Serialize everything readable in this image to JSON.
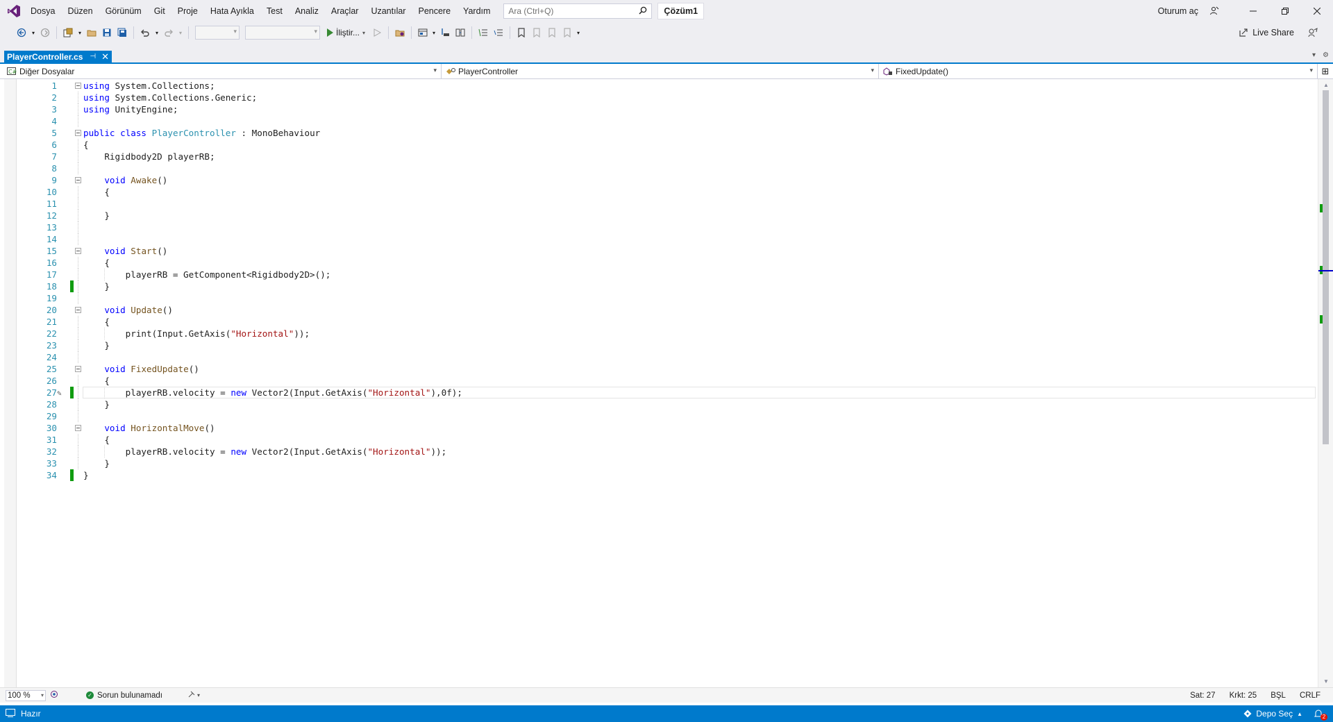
{
  "menu": {
    "items": [
      "Dosya",
      "Düzen",
      "Görünüm",
      "Git",
      "Proje",
      "Hata Ayıkla",
      "Test",
      "Analiz",
      "Araçlar",
      "Uzantılar",
      "Pencere",
      "Yardım"
    ],
    "search_placeholder": "Ara (Ctrl+Q)",
    "solution_name": "Çözüm1",
    "signin_label": "Oturum aç"
  },
  "toolbar": {
    "run_label": "İliştir...",
    "liveshare_label": "Live Share"
  },
  "tab": {
    "filename": "PlayerController.cs"
  },
  "navbar": {
    "project": "Diğer Dosyalar",
    "class": "PlayerController",
    "member": "FixedUpdate()"
  },
  "editor": {
    "lines": [
      "using System.Collections;",
      "using System.Collections.Generic;",
      "using UnityEngine;",
      "",
      "public class PlayerController : MonoBehaviour",
      "{",
      "    Rigidbody2D playerRB;",
      "",
      "    void Awake()",
      "    {",
      "",
      "    }",
      "",
      "",
      "    void Start()",
      "    {",
      "        playerRB = GetComponent<Rigidbody2D>();",
      "    }",
      "",
      "    void Update()",
      "    {",
      "        print(Input.GetAxis(\"Horizontal\"));",
      "    }",
      "",
      "    void FixedUpdate()",
      "    {",
      "        playerRB.velocity = new Vector2(Input.GetAxis(\"Horizontal\"),0f);",
      "    }",
      "",
      "    void HorizontalMove()",
      "    {",
      "        playerRB.velocity = new Vector2(Input.GetAxis(\"Horizontal\"));",
      "    }",
      "}"
    ],
    "current_line": 27,
    "fold_lines": [
      1,
      5,
      9,
      15,
      20,
      25,
      30
    ],
    "changed_lines": [
      18,
      27,
      34
    ]
  },
  "editor_status": {
    "zoom": "100 %",
    "issues": "Sorun bulunamadı",
    "line": "Sat: 27",
    "col": "Krkt: 25",
    "insert_mode": "BŞL",
    "eol": "CRLF"
  },
  "statusbar": {
    "ready": "Hazır",
    "repo": "Depo Seç",
    "notification_count": "2"
  },
  "colors": {
    "accent": "#007acc",
    "keyword": "#0000ff",
    "type": "#2b91af",
    "method": "#74531f",
    "string": "#a31515",
    "change_saved": "#109c10"
  }
}
